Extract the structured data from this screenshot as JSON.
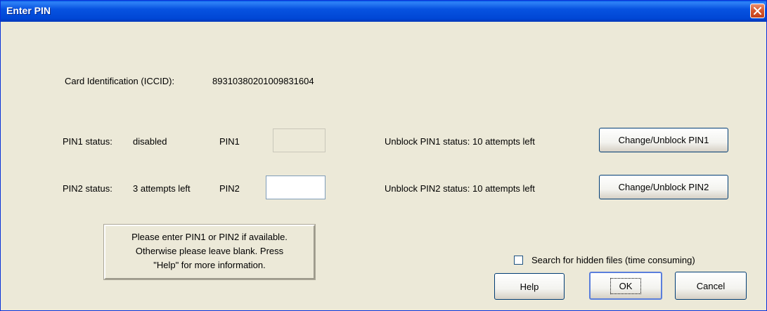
{
  "window": {
    "title": "Enter PIN",
    "close_glyph": "close-icon"
  },
  "card": {
    "label": "Card Identification (ICCID):",
    "value": "89310380201009831604"
  },
  "pin1": {
    "status_label": "PIN1 status:",
    "status_value": "disabled",
    "field_label": "PIN1",
    "field_value": "",
    "field_enabled": false,
    "unblock_status": "Unblock PIN1 status: 10 attempts left",
    "button_label": "Change/Unblock PIN1"
  },
  "pin2": {
    "status_label": "PIN2 status:",
    "status_value": "3 attempts left",
    "field_label": "PIN2",
    "field_value": "",
    "field_enabled": true,
    "unblock_status": "Unblock PIN2 status: 10 attempts left",
    "button_label": "Change/Unblock PIN2"
  },
  "info": {
    "line1": "Please enter PIN1 or PIN2 if available.",
    "line2": "Otherwise please leave blank.  Press",
    "line3": "\"Help\" for more information."
  },
  "options": {
    "hidden_files_label": "Search for hidden files (time consuming)",
    "hidden_files_checked": false
  },
  "buttons": {
    "help": "Help",
    "ok": "OK",
    "cancel": "Cancel"
  },
  "colors": {
    "titlebar": "#0046d5",
    "dialog_bg": "#ece9d8",
    "close_button": "#d6552b"
  }
}
